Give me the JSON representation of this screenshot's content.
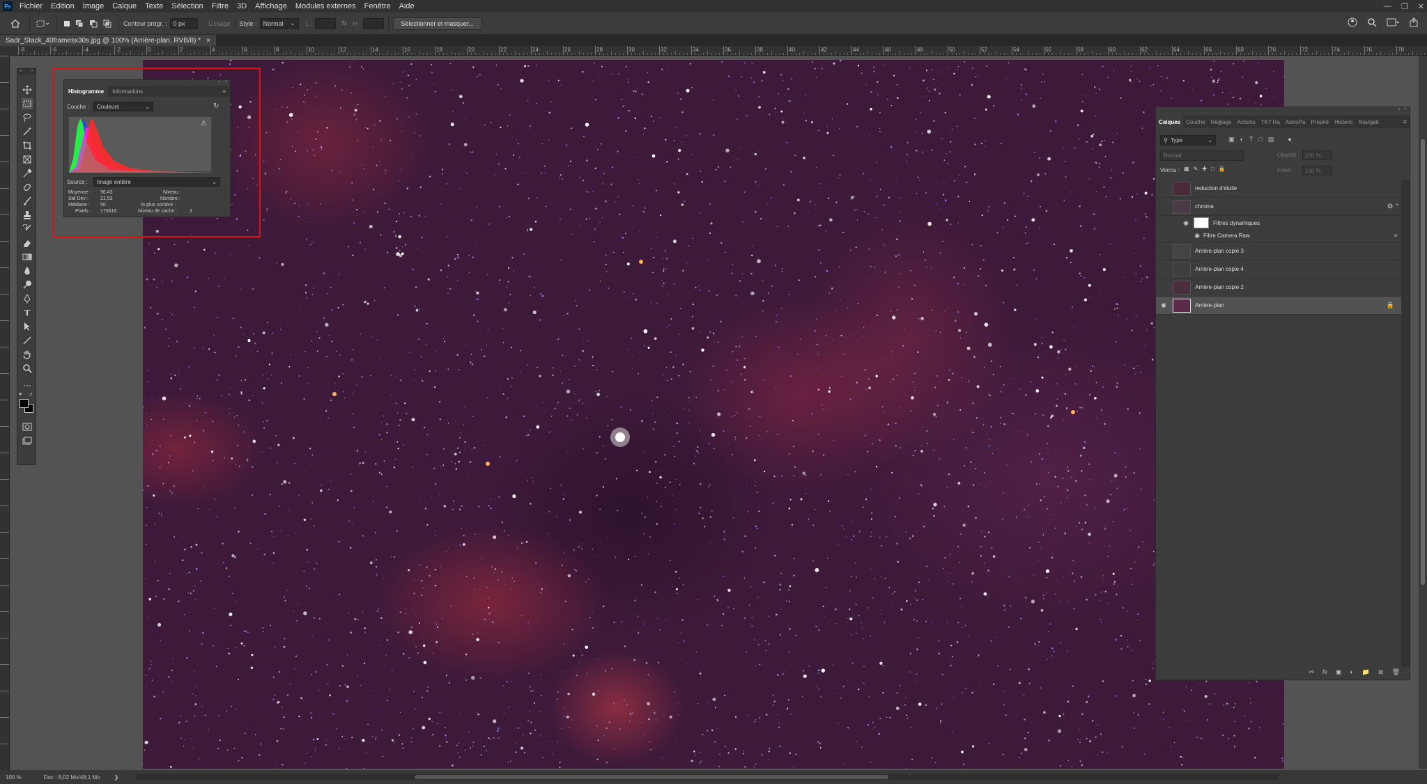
{
  "menu": {
    "items": [
      "Fichier",
      "Edition",
      "Image",
      "Calque",
      "Texte",
      "Sélection",
      "Filtre",
      "3D",
      "Affichage",
      "Modules externes",
      "Fenêtre",
      "Aide"
    ],
    "app_icon": "Ps"
  },
  "options": {
    "contour_label": "Contour progr. :",
    "contour_value": "0 px",
    "lissage_label": "Lissage",
    "style_label": "Style :",
    "style_value": "Normal",
    "l_label": "L :",
    "h_label": "H :",
    "select_mask_button": "Sélectionner et masquer..."
  },
  "document": {
    "tab_title": "Sadr_Stack_40framesx30s.jpg @ 100% (Arrière-plan, RVB/8) *",
    "close": "×"
  },
  "rulers": {
    "top_ticks": [
      "0",
      "2",
      "4",
      "6",
      "8",
      "10",
      "12",
      "14",
      "16",
      "18",
      "20",
      "22",
      "24",
      "26",
      "28",
      "30",
      "32",
      "34",
      "36",
      "38",
      "40",
      "42",
      "44",
      "46",
      "48",
      "50",
      "52",
      "54",
      "56",
      "58",
      "60",
      "62",
      "64",
      "66",
      "68",
      "70",
      "72",
      "74",
      "76",
      "78"
    ],
    "top_neg": [
      "-8",
      "-6",
      "-4",
      "-2"
    ]
  },
  "histogram": {
    "tabs": [
      "Histogramme",
      "Informations"
    ],
    "couche_label": "Couche :",
    "couche_value": "Couleurs",
    "source_label": "Source :",
    "source_value": "Image entière",
    "stats": {
      "moyenne_label": "Moyenne :",
      "moyenne": "56,43",
      "stddev_label": "Std Dev :",
      "stddev": "21,53",
      "mediane_label": "Médiane :",
      "mediane": "50",
      "pixels_label": "Pixels :",
      "pixels": "175616",
      "niveau_label": "Niveau :",
      "nombre_label": "Nombre :",
      "plus_sombre_label": "% plus sombre :",
      "cache_label": "Niveau de cache :",
      "cache": "3"
    }
  },
  "layers": {
    "tabs": [
      "Calques",
      "Couche",
      "Réglage",
      "Actions",
      "TK7 Ra",
      "AstroPa",
      "Proprié",
      "Historic",
      "Navigati"
    ],
    "filter_type": "Type",
    "blend_mode": "Normal",
    "opacity_label": "Opacité :",
    "opacity_value": "100 %",
    "lock_label": "Verrou :",
    "fill_label": "Fond :",
    "fill_value": "100 %",
    "items": [
      {
        "name": "reduction d'étoile"
      },
      {
        "name": "chroma"
      },
      {
        "name": "Filtres dynamiques"
      },
      {
        "name": "Filtre Camera Raw"
      },
      {
        "name": "Arrière-plan copie 3"
      },
      {
        "name": "Arrière-plan copie 4"
      },
      {
        "name": "Arrière-plan copie 2"
      },
      {
        "name": "Arrière-plan"
      }
    ]
  },
  "status": {
    "zoom": "100 %",
    "doc": "Doc : 8,02 Mo/48,1 Mo"
  },
  "colors": {
    "highlight": "#e01010",
    "histogram_red": "#ff2a2a",
    "histogram_green": "#20ff40",
    "histogram_blue": "#3a3aff",
    "histogram_magenta": "#ff20ff"
  }
}
